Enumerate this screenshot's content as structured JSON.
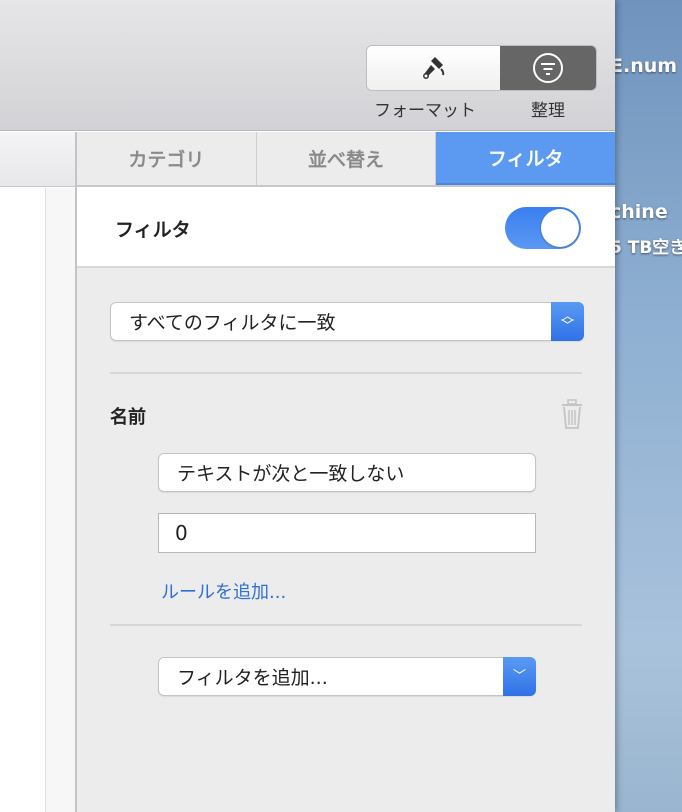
{
  "desktop": {
    "frag1": "E.num",
    "frag2": "chine",
    "frag3": "5 TB空き"
  },
  "toolbar": {
    "format_label": "フォーマット",
    "organize_label": "整理"
  },
  "tabs": [
    {
      "label": "カテゴリ"
    },
    {
      "label": "並べ替え"
    },
    {
      "label": "フィルタ",
      "active": true
    }
  ],
  "filter": {
    "title": "フィルタ",
    "enabled": true,
    "match_select": "すべてのフィルタに一致",
    "rule_column": "名前",
    "rule_condition": "テキストが次と一致しない",
    "rule_value": "0",
    "add_rule": "ルールを追加...",
    "add_filter": "フィルタを追加..."
  },
  "colors": {
    "accent": "#5b9af0",
    "link": "#2f6fd8"
  }
}
